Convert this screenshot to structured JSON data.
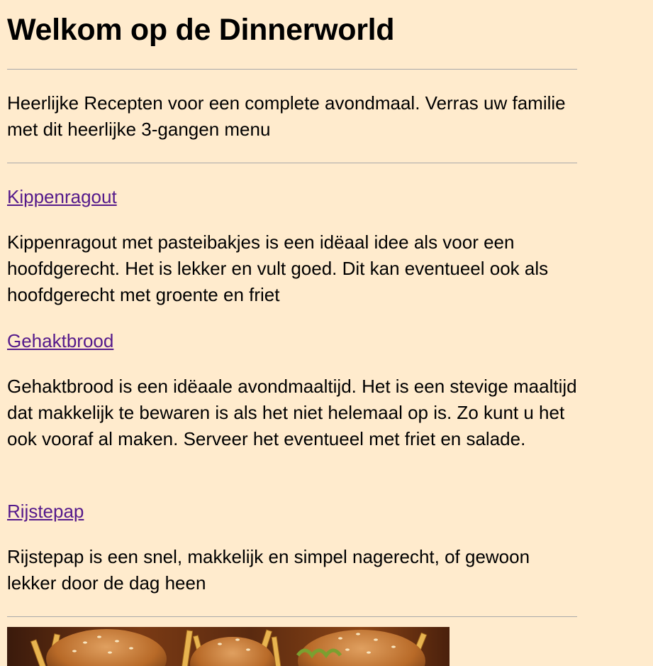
{
  "header": {
    "title": "Welkom op de Dinnerworld"
  },
  "intro": {
    "text": "Heerlijke Recepten voor een complete avondmaal. Verras uw familie met dit heerlijke 3-gangen menu"
  },
  "recipes": [
    {
      "link": "Kippenragout",
      "description": "Kippenragout met pasteibakjes is een idëaal idee als voor een hoofdgerecht. Het is lekker en vult goed. Dit kan eventueel ook als hoofdgerecht met groente en friet"
    },
    {
      "link": "Gehaktbrood",
      "description": "Gehaktbrood is een idëaale avondmaaltijd. Het is een stevige maaltijd dat makkelijk te bewaren is als het niet helemaal op is. Zo kunt u het ook vooraf al maken. Serveer het eventueel met friet en salade."
    },
    {
      "link": "Rijstepap",
      "description": "Rijstepap is een snel, makkelijk en simpel nagerecht, of gewoon lekker door de dag heen"
    }
  ],
  "colors": {
    "background": "#ffebcd",
    "link_visited": "#551a8b",
    "rule": "#a9a9a9"
  },
  "image": {
    "icon": "burger-fries-photo"
  }
}
